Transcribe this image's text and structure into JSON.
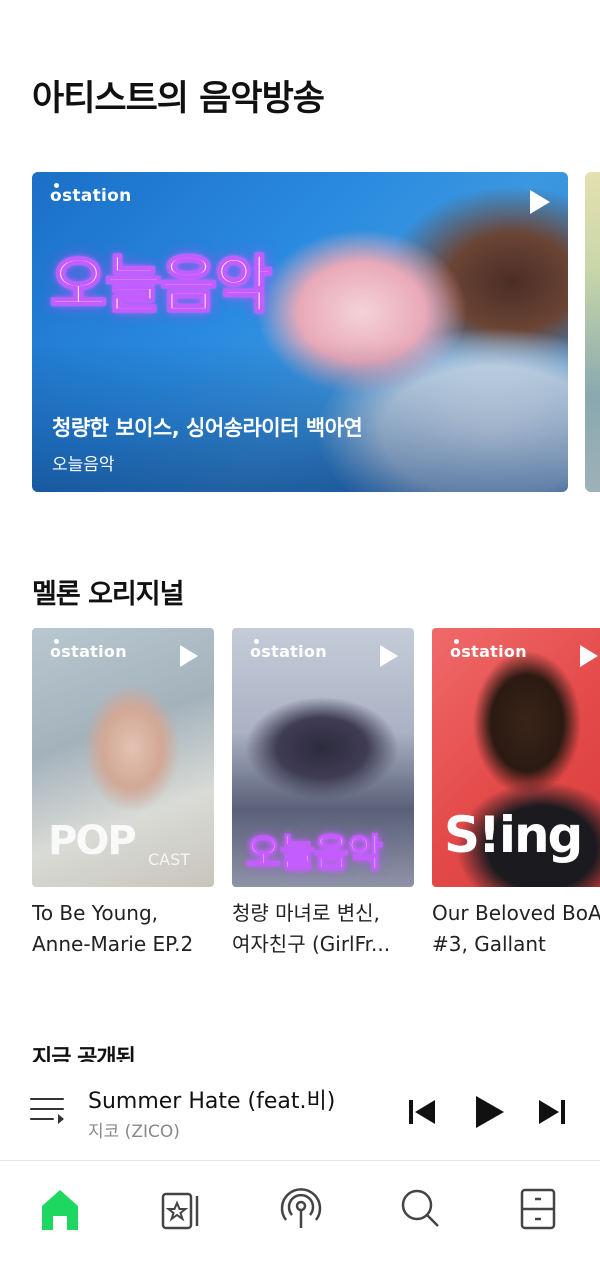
{
  "sections": {
    "artist_broadcast_title": "아티스트의 음악방송",
    "melon_original_title": "멜론 오리지널",
    "now_released_title": "지금 공개된"
  },
  "featured": {
    "brand": "station",
    "art_text": "오늘음악",
    "title": "청량한 보이스, 싱어송라이터 백아연",
    "subtitle": "오늘음악"
  },
  "originals": [
    {
      "brand": "station",
      "art_logo": "POP",
      "art_logo_suffix": "CAST",
      "caption_line1": "To Be Young,",
      "caption_line2": "Anne-Marie EP.2"
    },
    {
      "brand": "station",
      "art_text": "오늘음악",
      "caption_line1": "청량 마녀로 변신,",
      "caption_line2": "여자친구 (GirlFr..."
    },
    {
      "brand": "station",
      "art_logo": "S!ing",
      "caption_line1": "Our Beloved BoA",
      "caption_line2": "#3, Gallant"
    }
  ],
  "player": {
    "song_title": "Summer Hate (feat.비)",
    "artist": "지코 (ZICO)"
  },
  "nav": {
    "active": "home",
    "items": [
      "home-icon",
      "library-icon",
      "station-icon",
      "search-icon",
      "drawer-icon"
    ]
  },
  "colors": {
    "accent_green": "#1ed760",
    "text_primary": "#111111",
    "text_secondary": "#888888"
  }
}
